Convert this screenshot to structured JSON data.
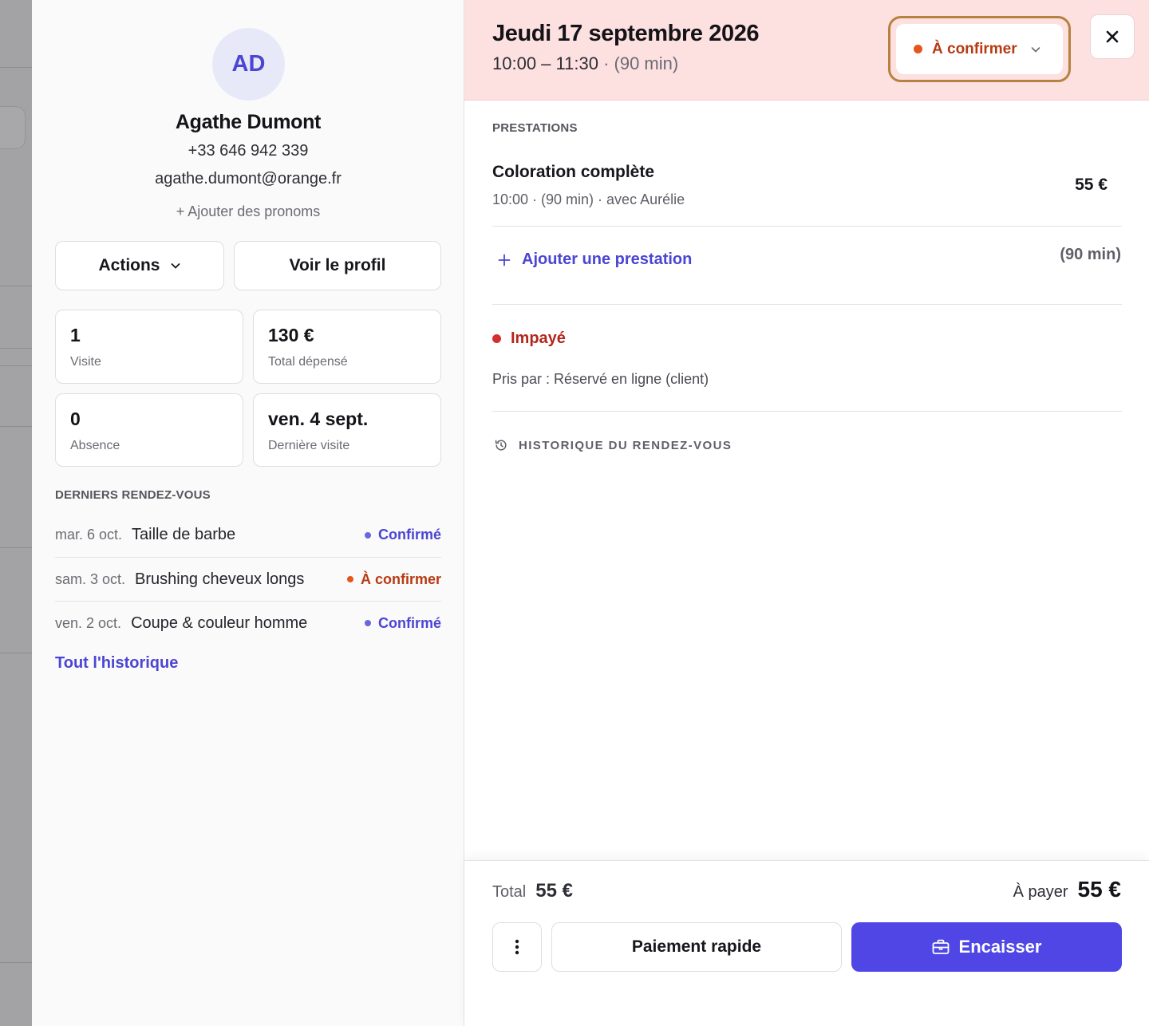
{
  "client": {
    "initials": "AD",
    "name": "Agathe Dumont",
    "phone": "+33 646 942 339",
    "email": "agathe.dumont@orange.fr",
    "add_pronouns": "+ Ajouter des pronoms",
    "actions_label": "Actions",
    "profile_label": "Voir le profil",
    "stats": [
      {
        "value": "1",
        "label": "Visite"
      },
      {
        "value": "130 €",
        "label": "Total dépensé"
      },
      {
        "value": "0",
        "label": "Absence"
      },
      {
        "value": "ven. 4 sept.",
        "label": "Dernière visite"
      }
    ],
    "recent_title": "DERNIERS RENDEZ-VOUS",
    "recent": [
      {
        "date": "mar. 6 oct.",
        "service": "Taille de barbe",
        "status": "Confirmé"
      },
      {
        "date": "sam. 3 oct.",
        "service": "Brushing cheveux longs",
        "status": "À confirmer"
      },
      {
        "date": "ven. 2 oct.",
        "service": "Coupe & couleur homme",
        "status": "Confirmé"
      }
    ],
    "all_history": "Tout l'historique"
  },
  "appointment": {
    "date": "Jeudi 17 septembre 2026",
    "time": "10:00 – 11:30",
    "duration": "· (90 min)",
    "status": "À confirmer",
    "services_title": "PRESTATIONS",
    "service": {
      "name": "Coloration complète",
      "meta": "10:00 · (90 min) · avec Aurélie",
      "price": "55 €"
    },
    "add_service": "Ajouter une prestation",
    "total_duration": "(90 min)",
    "payment_status": "Impayé",
    "taken_by": "Pris par : Réservé en ligne (client)",
    "history": "HISTORIQUE DU RENDEZ-VOUS"
  },
  "footer": {
    "total_label": "Total",
    "total_value": "55 €",
    "to_pay_label": "À payer",
    "to_pay_value": "55 €",
    "quick_pay": "Paiement rapide",
    "checkout": "Encaisser"
  },
  "colors": {
    "accent": "#4f46e5",
    "header_bg": "#fde0e0",
    "pending": "#e4561c",
    "unpaid": "#d32f2f",
    "status_outline": "#b7813f"
  },
  "icons": {
    "actions": "chevron-down-icon",
    "status": "chevron-down-icon",
    "close": "close-icon",
    "add_service": "plus-icon",
    "history": "history-icon",
    "more": "more-vertical-icon",
    "checkout": "register-icon"
  }
}
